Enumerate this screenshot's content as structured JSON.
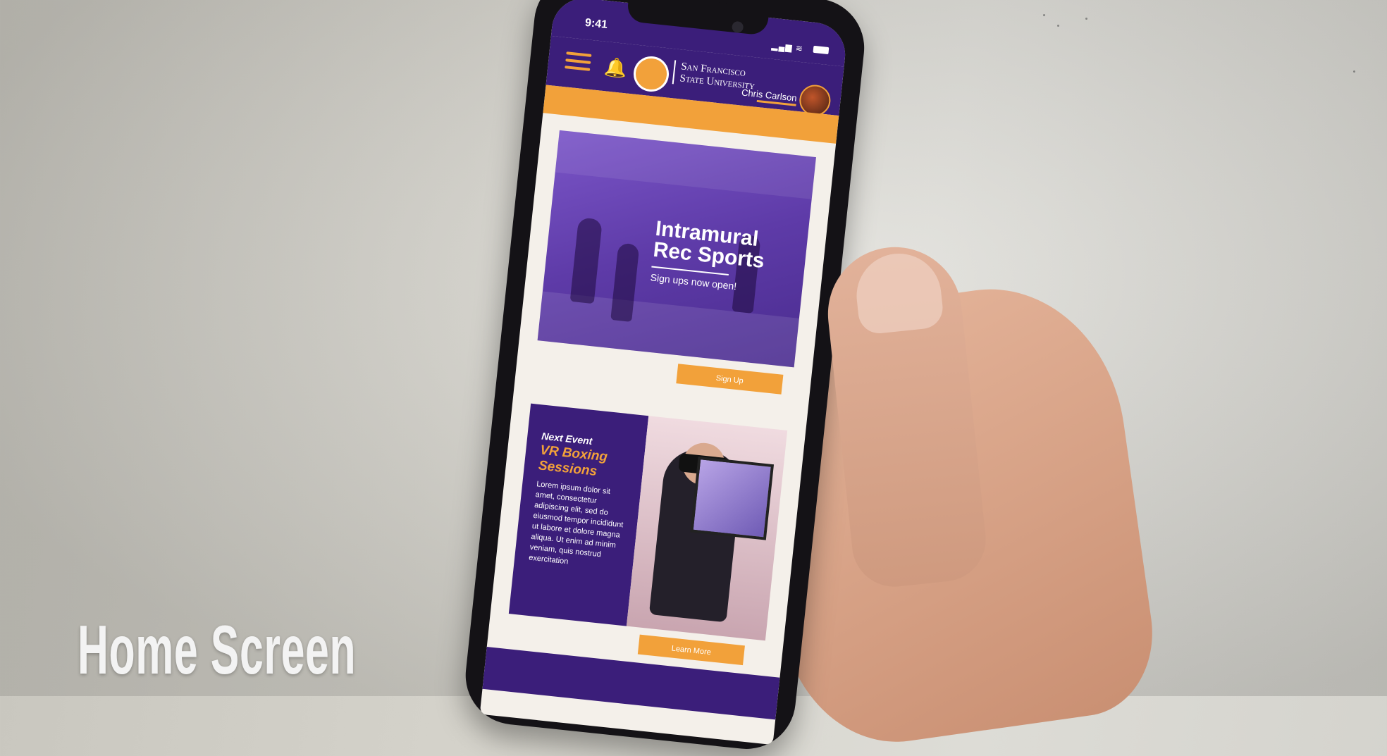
{
  "status_bar": {
    "time": "9:41"
  },
  "header": {
    "university_name_line1": "San Francisco",
    "university_name_line2": "State University",
    "user_name": "Chris Carlson"
  },
  "hero": {
    "title_line1": "Intramural",
    "title_line2": "Rec Sports",
    "subtitle": "Sign ups now open!",
    "button_label": "Sign Up"
  },
  "event": {
    "kicker": "Next Event",
    "title": "VR Boxing Sessions",
    "body": "Lorem ipsum dolor sit amet, consectetur adipiscing elit, sed do eiusmod tempor incididunt ut labore et dolore magna aliqua. Ut enim ad minim veniam, quis nostrud exercitation",
    "button_label": "Learn More"
  },
  "caption": "Home Screen",
  "colors": {
    "purple": "#3b1e7a",
    "orange": "#f2a13a"
  }
}
